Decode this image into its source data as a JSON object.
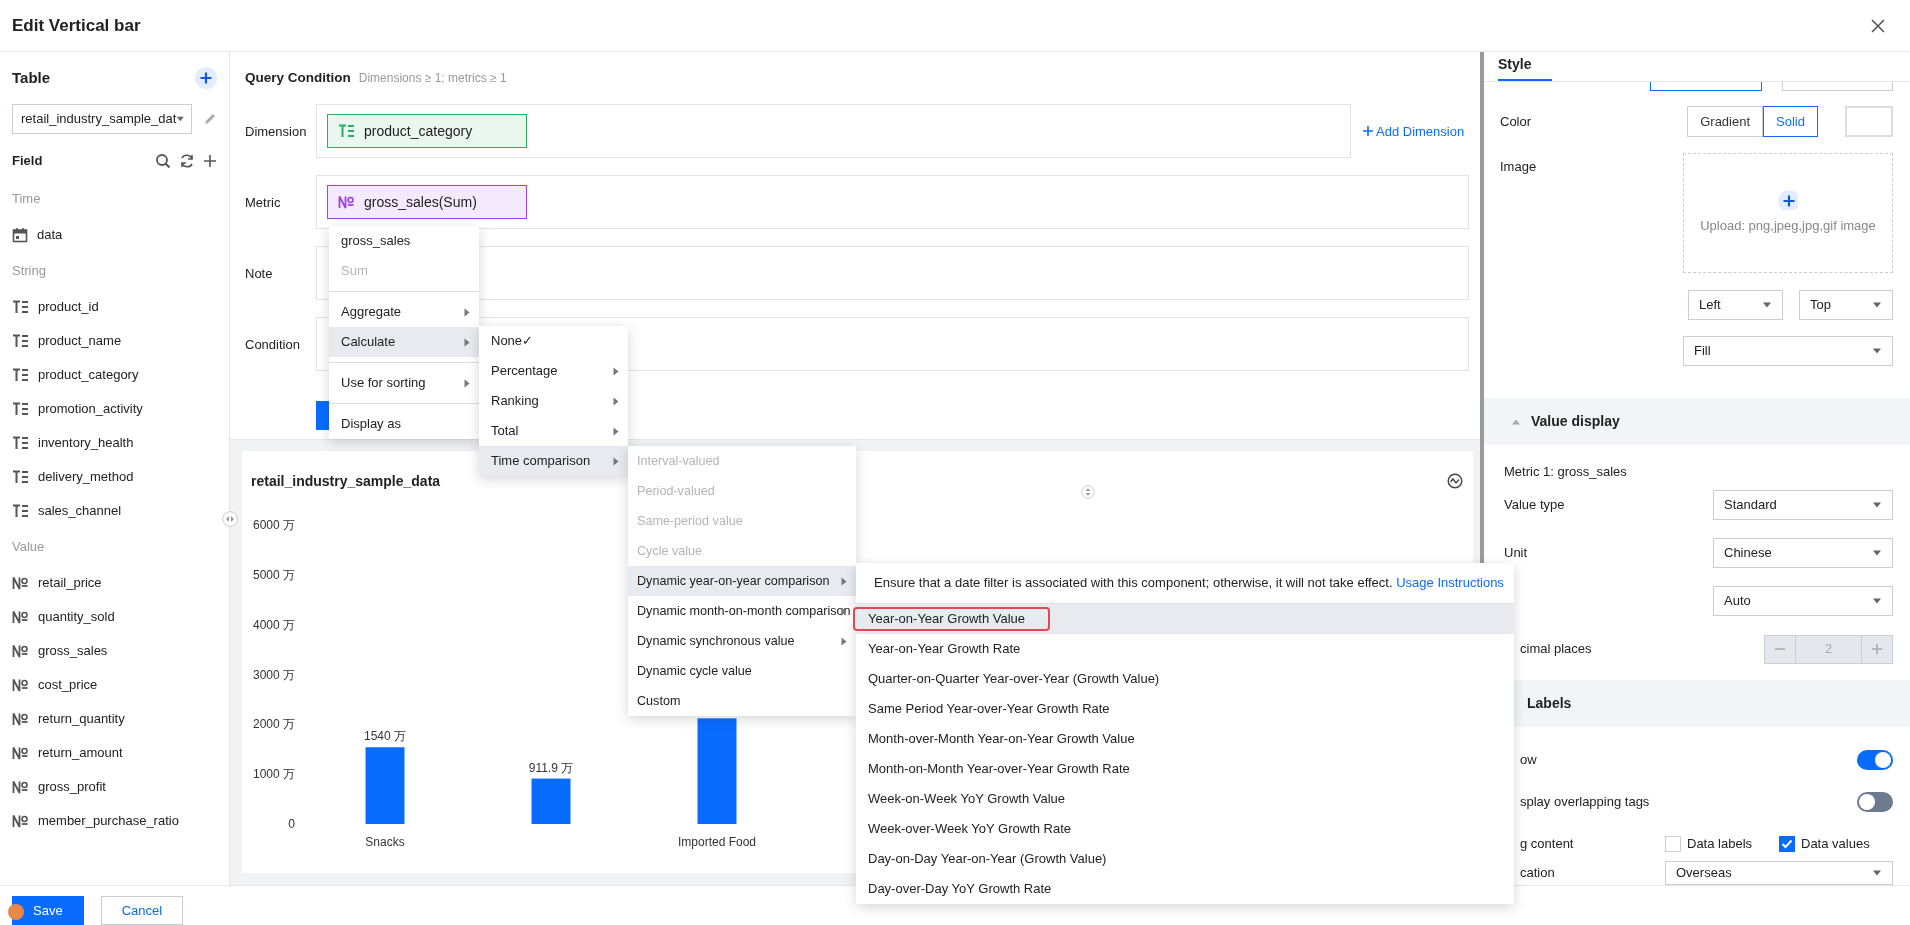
{
  "window": {
    "title": "Edit Vertical bar"
  },
  "sidebar": {
    "title": "Table",
    "table_select": "retail_industry_sample_dat",
    "field_title": "Field",
    "groups": [
      {
        "label": "Time",
        "items": [
          {
            "name": "data",
            "kind": "date"
          }
        ]
      },
      {
        "label": "String",
        "items": [
          {
            "name": "product_id",
            "kind": "text"
          },
          {
            "name": "product_name",
            "kind": "text"
          },
          {
            "name": "product_category",
            "kind": "text"
          },
          {
            "name": "promotion_activity",
            "kind": "text"
          },
          {
            "name": "inventory_health",
            "kind": "text"
          },
          {
            "name": "delivery_method",
            "kind": "text"
          },
          {
            "name": "sales_channel",
            "kind": "text"
          }
        ]
      },
      {
        "label": "Value",
        "items": [
          {
            "name": "retail_price",
            "kind": "number"
          },
          {
            "name": "quantity_sold",
            "kind": "number"
          },
          {
            "name": "gross_sales",
            "kind": "number"
          },
          {
            "name": "cost_price",
            "kind": "number"
          },
          {
            "name": "return_quantity",
            "kind": "number"
          },
          {
            "name": "return_amount",
            "kind": "number"
          },
          {
            "name": "gross_profit",
            "kind": "number"
          },
          {
            "name": "member_purchase_ratio",
            "kind": "number"
          }
        ]
      }
    ]
  },
  "query": {
    "title": "Query Condition",
    "hint": "Dimensions ≥ 1; metrics ≥ 1",
    "rows": [
      {
        "label": "Dimension",
        "chips": [
          {
            "text": "product_category",
            "kind": "dimension"
          }
        ],
        "action": "Add Dimension"
      },
      {
        "label": "Metric",
        "chips": [
          {
            "text": "gross_sales(Sum)",
            "kind": "metric"
          }
        ]
      },
      {
        "label": "Note"
      },
      {
        "label": "Condition"
      }
    ]
  },
  "chart": {
    "title": "retail_industry_sample_data",
    "chart_data": {
      "type": "bar",
      "categories": [
        "Snacks",
        null,
        "Imported Food"
      ],
      "values": [
        1540,
        911.9,
        2120
      ],
      "ylim": [
        0,
        6000
      ],
      "yticks": [
        {
          "value": 0,
          "label": "0"
        },
        {
          "value": 1000,
          "label": "1000 万"
        },
        {
          "value": 2000,
          "label": "2000 万"
        },
        {
          "value": 3000,
          "label": "3000 万"
        },
        {
          "value": 4000,
          "label": "4000 万"
        },
        {
          "value": 5000,
          "label": "5000 万"
        },
        {
          "value": 6000,
          "label": "6000 万"
        }
      ],
      "value_labels": [
        "1540 万",
        "911.9 万",
        null
      ]
    }
  },
  "menus": [
    {
      "groups": [
        {
          "items": [
            {
              "label": "gross_sales",
              "selected": false,
              "disabled": false,
              "submenu": false
            },
            {
              "label": "Sum",
              "selected": false,
              "disabled": true,
              "submenu": false
            }
          ]
        },
        {
          "items": [
            {
              "label": "Aggregate",
              "selected": false,
              "disabled": false,
              "submenu": true
            },
            {
              "label": "Calculate",
              "selected": true,
              "disabled": false,
              "submenu": true
            }
          ]
        },
        {
          "items": [
            {
              "label": "Use for sorting",
              "selected": false,
              "disabled": false,
              "submenu": true
            }
          ]
        },
        {
          "items": [
            {
              "label": "Display as",
              "selected": false,
              "disabled": false,
              "submenu": false
            }
          ]
        }
      ]
    },
    {
      "groups": [
        {
          "items": [
            {
              "label": "None✓",
              "selected": false,
              "disabled": false,
              "submenu": false
            },
            {
              "label": "Percentage",
              "selected": false,
              "disabled": false,
              "submenu": true
            },
            {
              "label": "Ranking",
              "selected": false,
              "disabled": false,
              "submenu": true
            },
            {
              "label": "Total",
              "selected": false,
              "disabled": false,
              "submenu": true
            },
            {
              "label": "Time comparison",
              "selected": true,
              "disabled": false,
              "submenu": true
            }
          ]
        }
      ]
    },
    {
      "groups": [
        {
          "items": [
            {
              "label": "Interval-valued",
              "selected": false,
              "disabled": true,
              "submenu": false
            },
            {
              "label": "Period-valued",
              "selected": false,
              "disabled": true,
              "submenu": false
            },
            {
              "label": "Same-period value",
              "selected": false,
              "disabled": true,
              "submenu": false
            },
            {
              "label": "Cycle value",
              "selected": false,
              "disabled": true,
              "submenu": false
            },
            {
              "label": "Dynamic year-on-year comparison",
              "selected": true,
              "disabled": false,
              "submenu": true
            },
            {
              "label": "Dynamic month-on-month comparison",
              "selected": false,
              "disabled": false,
              "submenu": true
            },
            {
              "label": "Dynamic synchronous value",
              "selected": false,
              "disabled": false,
              "submenu": true
            },
            {
              "label": "Dynamic cycle value",
              "selected": false,
              "disabled": false,
              "submenu": false
            },
            {
              "label": "Custom",
              "selected": false,
              "disabled": false,
              "submenu": false
            }
          ]
        }
      ]
    },
    {
      "note": "Ensure that a date filter is associated with this component; otherwise, it will not take effect.",
      "link": "Usage Instructions",
      "groups": [
        {
          "items": [
            {
              "label": "Year-on-Year Growth Value",
              "selected": true,
              "disabled": false,
              "submenu": false
            },
            {
              "label": "Year-on-Year Growth Rate",
              "selected": false,
              "disabled": false,
              "submenu": false
            },
            {
              "label": "Quarter-on-Quarter Year-over-Year (Growth Value)",
              "selected": false,
              "disabled": false,
              "submenu": false
            },
            {
              "label": "Same Period Year-over-Year Growth Rate",
              "selected": false,
              "disabled": false,
              "submenu": false
            },
            {
              "label": "Month-over-Month Year-on-Year Growth Value",
              "selected": false,
              "disabled": false,
              "submenu": false
            },
            {
              "label": "Month-on-Month Year-over-Year Growth Rate",
              "selected": false,
              "disabled": false,
              "submenu": false
            },
            {
              "label": "Week-on-Week YoY Growth Value",
              "selected": false,
              "disabled": false,
              "submenu": false
            },
            {
              "label": "Week-over-Week YoY Growth Rate",
              "selected": false,
              "disabled": false,
              "submenu": false
            },
            {
              "label": "Day-on-Day Year-on-Year (Growth Value)",
              "selected": false,
              "disabled": false,
              "submenu": false
            },
            {
              "label": "Day-over-Day YoY Growth Rate",
              "selected": false,
              "disabled": false,
              "submenu": false
            }
          ]
        }
      ]
    }
  ],
  "style_panel": {
    "tabs": [
      {
        "label": "Style",
        "selected": true
      }
    ],
    "top_options": [
      {
        "selected": true
      },
      {
        "selected": false
      }
    ],
    "color": {
      "label": "Color",
      "options": [
        {
          "label": "Gradient",
          "selected": false
        },
        {
          "label": "Solid",
          "selected": true
        }
      ]
    },
    "image": {
      "label": "Image",
      "upload_hint": "Upload: png,jpeg,jpg,gif image",
      "h_align": "Left",
      "v_align": "Top",
      "fit": "Fill"
    },
    "sections": [
      {
        "title": "Value display",
        "expanded": true,
        "rows": [
          {
            "kind": "text",
            "label": "Metric 1: gross_sales"
          },
          {
            "kind": "select",
            "label": "Value type",
            "value": "Standard"
          },
          {
            "kind": "select",
            "label": "Unit",
            "value": "Chinese"
          },
          {
            "kind": "select",
            "value": "Auto"
          },
          {
            "kind": "stepper",
            "label": "cimal places",
            "clipped": true,
            "value": "2",
            "disabled": true
          }
        ]
      },
      {
        "title": "Labels",
        "rows": [
          {
            "kind": "switch",
            "label": "ow",
            "clipped": true,
            "on": true
          },
          {
            "kind": "switch",
            "label": "splay overlapping tags",
            "clipped": true,
            "on": false
          },
          {
            "kind": "checks",
            "label": "g content",
            "clipped": true,
            "options": [
              {
                "label": "Data labels",
                "checked": false
              },
              {
                "label": "Data values",
                "checked": true
              }
            ]
          },
          {
            "kind": "select",
            "label": "cation",
            "clipped": true,
            "value": "Overseas"
          }
        ]
      }
    ]
  },
  "footer": {
    "buttons": [
      {
        "label": "Save",
        "kind": "primary"
      },
      {
        "label": "Cancel",
        "kind": "secondary"
      }
    ]
  }
}
